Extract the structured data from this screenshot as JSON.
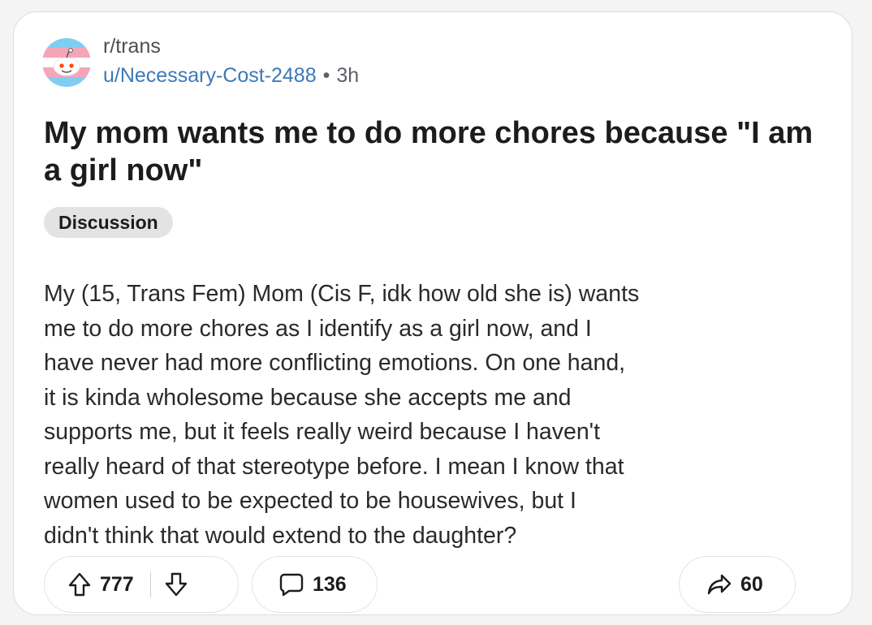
{
  "post": {
    "subreddit": "r/trans",
    "author": "u/Necessary-Cost-2488",
    "separator": "•",
    "time": "3h",
    "title": "My mom wants me to do more chores because \"I am a girl now\"",
    "flair": "Discussion",
    "body": "My (15, Trans Fem) Mom (Cis F, idk how old she is) wants\nme to do more chores as I identify as a girl now, and I\nhave never had more conflicting emotions. On one hand,\nit is kinda wholesome because she accepts me and\nsupports me, but it feels really weird because I haven't\nreally heard of that stereotype before. I mean I know that\nwomen used to be expected to be housewives, but I\ndidn't think that would extend to the daughter?"
  },
  "actions": {
    "upvotes": "777",
    "comments": "136",
    "shares": "60"
  },
  "icons": {
    "avatar": "trans-flag-snoo-icon",
    "upvote": "upvote-arrow-icon",
    "downvote": "downvote-arrow-icon",
    "comment": "comment-bubble-icon",
    "share": "share-arrow-icon"
  },
  "colors": {
    "flag_blue": "#7fcdf2",
    "flag_pink": "#f4a6b8",
    "flag_white": "#ffffff",
    "link": "#3b79b8",
    "flair_bg": "#e3e3e3"
  }
}
